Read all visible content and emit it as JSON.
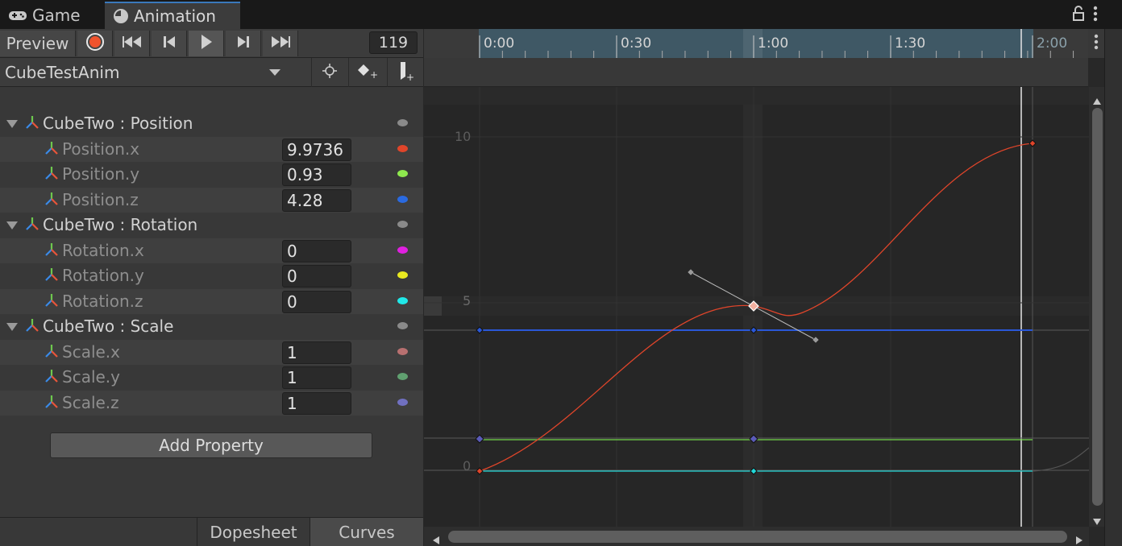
{
  "tabs": [
    {
      "label": "Game",
      "icon": "gamepad-icon"
    },
    {
      "label": "Animation",
      "icon": "clock-icon"
    }
  ],
  "toolbar": {
    "preview_label": "Preview",
    "frame": "119"
  },
  "clip": {
    "name": "CubeTestAnim"
  },
  "properties": [
    {
      "label": "CubeTwo : Position",
      "group": true,
      "color": "#8a8a8a"
    },
    {
      "label": "Position.x",
      "value": "9.9736",
      "color": "#e0452a"
    },
    {
      "label": "Position.y",
      "value": "0.93",
      "color": "#8ee84e"
    },
    {
      "label": "Position.z",
      "value": "4.28",
      "color": "#2a6ae0"
    },
    {
      "label": "CubeTwo : Rotation",
      "group": true,
      "color": "#8a8a8a"
    },
    {
      "label": "Rotation.x",
      "value": "0",
      "color": "#e020e0"
    },
    {
      "label": "Rotation.y",
      "value": "0",
      "color": "#e8e820"
    },
    {
      "label": "Rotation.z",
      "value": "0",
      "color": "#20e8e8"
    },
    {
      "label": "CubeTwo : Scale",
      "group": true,
      "color": "#8a8a8a"
    },
    {
      "label": "Scale.x",
      "value": "1",
      "color": "#b87070"
    },
    {
      "label": "Scale.y",
      "value": "1",
      "color": "#60a070"
    },
    {
      "label": "Scale.z",
      "value": "1",
      "color": "#7070c0"
    }
  ],
  "add_property_label": "Add Property",
  "bottom_tabs": {
    "dopesheet": "Dopesheet",
    "curves": "Curves"
  },
  "timeline": {
    "ticks": [
      "0:00",
      "0:30",
      "1:00",
      "1:30",
      "2:00"
    ]
  },
  "curve_axis_labels": [
    "10",
    "5",
    "0"
  ]
}
